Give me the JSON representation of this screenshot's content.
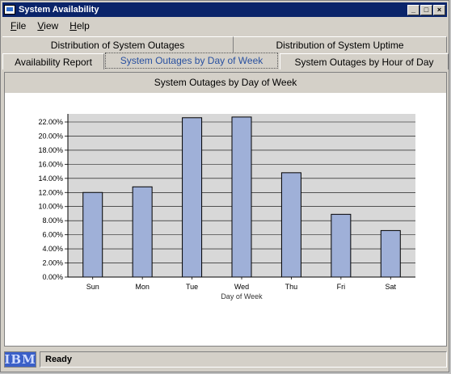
{
  "window": {
    "title": "System Availability",
    "min": "_",
    "max": "□",
    "close": "×"
  },
  "menu": {
    "file": "File",
    "view": "View",
    "help": "Help"
  },
  "tabs": {
    "row1": [
      "Distribution of System Outages",
      "Distribution of System Uptime"
    ],
    "row2": [
      "Availability Report",
      "System Outages by Day of Week",
      "System Outages by Hour of Day"
    ],
    "active": "System Outages by Day of Week"
  },
  "panel": {
    "header": "System Outages by Day of Week"
  },
  "status": {
    "brand": "IBM",
    "text": "Ready"
  },
  "colors": {
    "bar": "#9fb0d8",
    "title_bar": "#0a246a",
    "active_tab": "#2850a0"
  },
  "chart_data": {
    "type": "bar",
    "categories": [
      "Sun",
      "Mon",
      "Tue",
      "Wed",
      "Thu",
      "Fri",
      "Sat"
    ],
    "values": [
      12.0,
      12.8,
      22.6,
      22.7,
      14.8,
      8.9,
      6.6
    ],
    "xlabel": "Day of Week",
    "ylabel": "",
    "ylim": [
      0,
      22
    ],
    "yticks": [
      "0.00%",
      "2.00%",
      "4.00%",
      "6.00%",
      "8.00%",
      "10.00%",
      "12.00%",
      "14.00%",
      "16.00%",
      "18.00%",
      "20.00%",
      "22.00%"
    ],
    "grid": true
  }
}
